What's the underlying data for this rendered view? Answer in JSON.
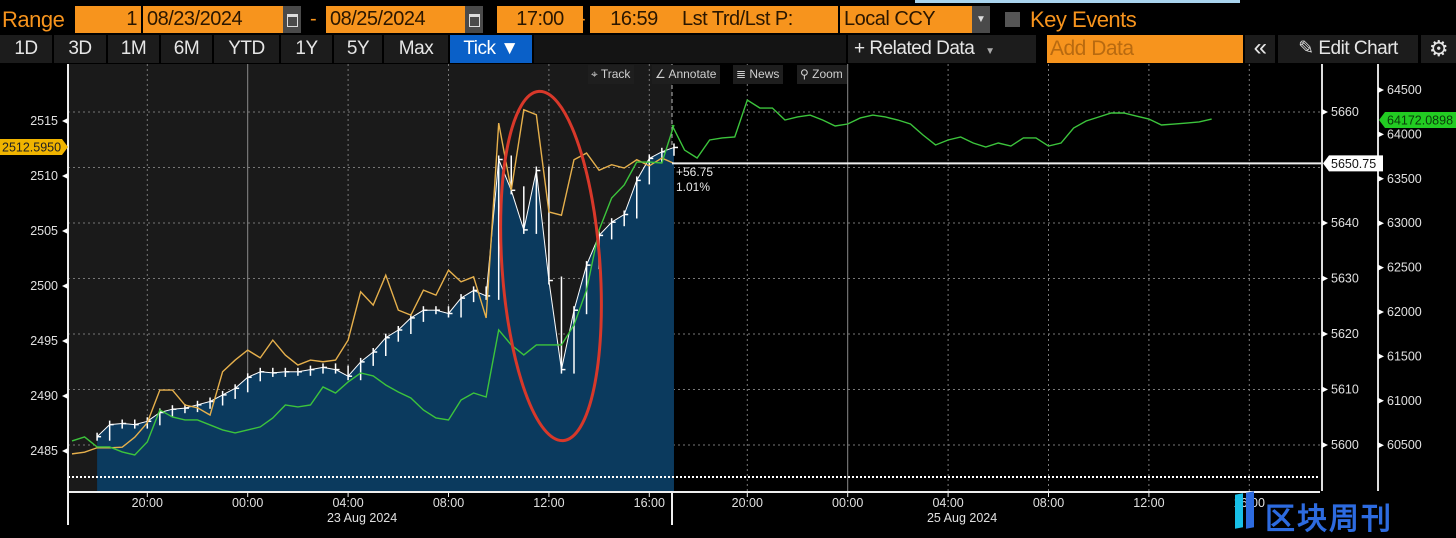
{
  "toolbar": {
    "range_label": "Range",
    "range_value": "1",
    "start_date": "08/23/2024",
    "end_date": "08/25/2024",
    "date_separator": "-",
    "start_time": "17:00",
    "end_time": "16:59",
    "price_type": "Lst Trd/Lst P:",
    "currency": "Local CCY",
    "key_events": "Key Events",
    "periods": [
      "1D",
      "3D",
      "1M",
      "6M",
      "YTD",
      "1Y",
      "5Y",
      "Max"
    ],
    "tick": "Tick ▼",
    "related_data": "+ Related Data",
    "add_data_placeholder": "Add Data",
    "collapse": "«",
    "edit_chart": "Edit Chart",
    "accent_color": "#f7941d",
    "active_color": "#0a60c8"
  },
  "chart_tools": {
    "track": "Track",
    "annotate": "Annotate",
    "news": "News",
    "zoom": "Zoom"
  },
  "watermark": {
    "text": "区块周刊",
    "color": "#2d6be0"
  },
  "chart_data": {
    "type": "line",
    "grid": true,
    "x_ticks": [
      {
        "time": "08/22 20:00",
        "label": "20:00"
      },
      {
        "time": "08/23 00:00",
        "label": "00:00"
      },
      {
        "time": "08/23 04:00",
        "label": "04:00"
      },
      {
        "time": "08/23 08:00",
        "label": "08:00"
      },
      {
        "time": "08/23 12:00",
        "label": "12:00"
      },
      {
        "time": "08/23 16:00",
        "label": "16:00"
      },
      {
        "time": "08/24 20:00",
        "label": "20:00"
      },
      {
        "time": "08/25 00:00",
        "label": "00:00"
      },
      {
        "time": "08/25 04:00",
        "label": "04:00"
      },
      {
        "time": "08/25 08:00",
        "label": "08:00"
      },
      {
        "time": "08/25 12:00",
        "label": "12:00"
      },
      {
        "time": "08/25 16:00",
        "label": "16:00"
      }
    ],
    "date_labels": [
      {
        "time": "08/23 04:00",
        "label": "23 Aug 2024"
      },
      {
        "time": "08/25 04:00",
        "label": "25 Aug 2024"
      }
    ],
    "axes": {
      "left": {
        "ticks": [
          2485,
          2490,
          2495,
          2500,
          2505,
          2510,
          2515
        ],
        "last_label": "2512.5950",
        "last_color": "#f0b400"
      },
      "middle": {
        "ticks": [
          5600,
          5610,
          5620,
          5630,
          5640,
          5660
        ],
        "last_label": "5650.75",
        "last_color": "#ffffff"
      },
      "right": {
        "ticks": [
          60500,
          61000,
          61500,
          62000,
          62500,
          63000,
          63500,
          64000,
          64500
        ],
        "last_label": "64172.0898",
        "last_color": "#22cc22"
      }
    },
    "change": {
      "abs": "+56.75",
      "pct": "1.01%"
    },
    "segments": [
      {
        "times": [
          "08/22 17:00",
          "08/22 17:30",
          "08/22 18:00",
          "08/22 18:30",
          "08/22 19:00",
          "08/22 19:30",
          "08/22 20:00",
          "08/22 20:30",
          "08/22 21:00",
          "08/22 21:30",
          "08/22 22:00",
          "08/22 22:30",
          "08/22 23:00",
          "08/22 23:30",
          "08/23 00:00",
          "08/23 00:30",
          "08/23 01:00",
          "08/23 01:30",
          "08/23 02:00",
          "08/23 02:30",
          "08/23 03:00",
          "08/23 03:30",
          "08/23 04:00",
          "08/23 04:30",
          "08/23 05:00",
          "08/23 05:30",
          "08/23 06:00",
          "08/23 06:30",
          "08/23 07:00",
          "08/23 07:30",
          "08/23 08:00",
          "08/23 08:30",
          "08/23 09:00",
          "08/23 09:30",
          "08/23 10:00",
          "08/23 10:30",
          "08/23 11:00",
          "08/23 11:30",
          "08/23 12:00",
          "08/23 12:30",
          "08/23 13:00",
          "08/23 13:30",
          "08/23 14:00",
          "08/23 14:30",
          "08/23 15:00",
          "08/23 15:30",
          "08/23 16:00",
          "08/23 16:30",
          "08/23 16:59"
        ],
        "white": [
          null,
          null,
          2486.3,
          2487.4,
          2487.5,
          2487.4,
          2487.7,
          2488.5,
          2488.8,
          2488.9,
          2489.2,
          2489.5,
          2490.1,
          2490.7,
          2491.7,
          2492.2,
          2492.1,
          2492.2,
          2492.2,
          2492.4,
          2492.6,
          2492.4,
          2491.8,
          2493.1,
          2494.0,
          2495.3,
          2496.0,
          2497.1,
          2497.8,
          2497.8,
          2497.5,
          2498.9,
          2499.6,
          2499.1,
          2511.5,
          2508.7,
          2505.1,
          2510.5,
          2500.5,
          2492.4,
          2497.8,
          2501.9,
          2504.6,
          2505.8,
          2506.5,
          2509.6,
          2511.6,
          2512.2,
          2512.595
        ],
        "orange": [
          5598.4,
          5598.7,
          5599.5,
          5599.5,
          5599.6,
          5601.4,
          5604.0,
          5609.9,
          5609.9,
          5607.2,
          5606.7,
          5605.4,
          5613.2,
          5615.3,
          5617.1,
          5615.7,
          5618.9,
          5616.2,
          5614.4,
          5615.3,
          5615.0,
          5615.3,
          5618.9,
          5627.6,
          5625.2,
          5630.6,
          5624.3,
          5623.4,
          5627.9,
          5627.0,
          5631.5,
          5629.4,
          5630.3,
          5622.9,
          5658.0,
          5645.9,
          5660.4,
          5659.5,
          5642.0,
          5641.4,
          5651.4,
          5652.6,
          5649.5,
          5650.5,
          5649.9,
          5651.4,
          5650.3,
          5651.7,
          5650.75
        ],
        "green": [
          60548,
          60593,
          60480,
          60480,
          60424,
          60390,
          60537,
          60897,
          60818,
          60784,
          60784,
          60728,
          60672,
          60638,
          60672,
          60706,
          60807,
          60953,
          60931,
          60953,
          61156,
          61088,
          61212,
          61313,
          61280,
          61178,
          61099,
          61032,
          60897,
          60807,
          60784,
          61009,
          61088,
          61043,
          61798,
          61629,
          61516,
          61629,
          61629,
          61629,
          61854,
          62248,
          62924,
          63284,
          63430,
          63689,
          63689,
          63678,
          64106
        ]
      },
      {
        "times": [
          "08/24 17:00",
          "08/24 17:30",
          "08/24 18:00",
          "08/24 18:30",
          "08/24 19:00",
          "08/24 19:30",
          "08/24 20:00",
          "08/24 20:30",
          "08/24 21:00",
          "08/24 21:30",
          "08/24 22:00",
          "08/24 22:30",
          "08/24 23:00",
          "08/24 23:30",
          "08/25 00:00",
          "08/25 00:30",
          "08/25 01:00",
          "08/25 01:30",
          "08/25 02:00",
          "08/25 02:30",
          "08/25 03:00",
          "08/25 03:30",
          "08/25 04:00",
          "08/25 04:30",
          "08/25 05:00",
          "08/25 05:30",
          "08/25 06:00",
          "08/25 06:30",
          "08/25 07:00",
          "08/25 07:30",
          "08/25 08:00",
          "08/25 08:30",
          "08/25 09:00",
          "08/25 09:30",
          "08/25 10:00",
          "08/25 10:30",
          "08/25 11:00",
          "08/25 11:30",
          "08/25 12:00",
          "08/25 12:30",
          "08/25 13:00",
          "08/25 13:30",
          "08/25 14:00",
          "08/25 14:30"
        ],
        "green": [
          64106,
          63824,
          63734,
          63937,
          63960,
          63971,
          64387,
          64297,
          64297,
          64162,
          64196,
          64218,
          64162,
          64095,
          64117,
          64185,
          64218,
          64196,
          64162,
          64117,
          63993,
          63881,
          63937,
          63971,
          63903,
          63858,
          63903,
          63869,
          63960,
          63960,
          63869,
          63903,
          64072,
          64151,
          64196,
          64241,
          64241,
          64207,
          64173,
          64106,
          64117,
          64128,
          64140,
          64172.0898
        ]
      }
    ],
    "series": [
      {
        "key": "white",
        "axis": "left",
        "style": "tick-bars",
        "color": "#ffffff",
        "fill": "#0b3a5e"
      },
      {
        "key": "orange",
        "axis": "middle",
        "style": "line",
        "color": "#e6b04c"
      },
      {
        "key": "green",
        "axis": "right",
        "style": "line",
        "color": "#3cc43c"
      }
    ],
    "annotation": {
      "shape": "ellipse",
      "color": "#d8382a"
    }
  }
}
